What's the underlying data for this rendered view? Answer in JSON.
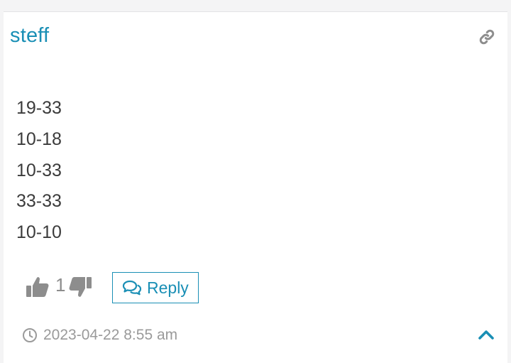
{
  "comment": {
    "author": "steff",
    "content_lines": [
      "19-33",
      "10-18",
      "10-33",
      "33-33",
      "10-10"
    ],
    "vote_count": "1",
    "reply_label": "Reply",
    "timestamp": "2023-04-22 8:55 am"
  },
  "icons": {
    "permalink": "link-icon",
    "upvote": "thumbs-up-icon",
    "downvote": "thumbs-down-icon",
    "reply": "chat-bubbles-icon",
    "time": "clock-icon",
    "scroll_top": "chevron-up-icon"
  },
  "colors": {
    "accent": "#1a8fb5",
    "muted_icon": "#8d8d8d",
    "text": "#3b3b3b",
    "timestamp": "#9a9a9a"
  }
}
